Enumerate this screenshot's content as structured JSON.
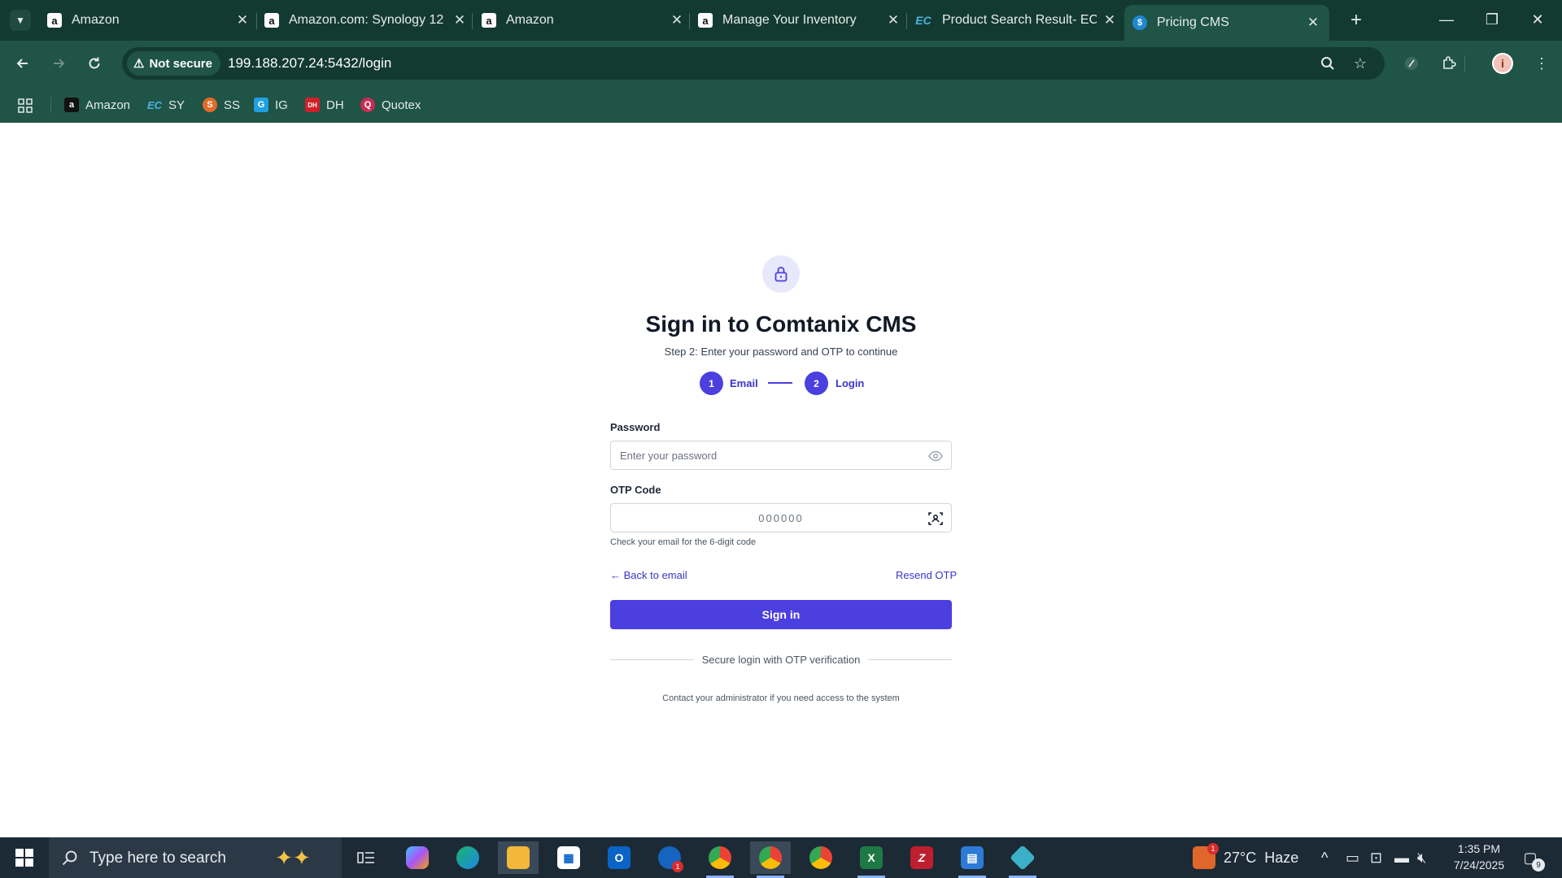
{
  "browser": {
    "tabs": [
      {
        "title": "Amazon",
        "favicon": "amazon-icon"
      },
      {
        "title": "Amazon.com: Synology 12",
        "favicon": "amazon-icon"
      },
      {
        "title": "Amazon",
        "favicon": "amazon-icon"
      },
      {
        "title": "Manage Your Inventory",
        "favicon": "amazon-icon"
      },
      {
        "title": "Product Search Result- ECF",
        "favicon": "ec-icon"
      },
      {
        "title": "Pricing CMS",
        "favicon": "pricing-cms-icon",
        "active": true
      }
    ],
    "security_label": "Not secure",
    "url": "199.188.207.24:5432/login",
    "bookmarks": [
      {
        "label": "Amazon",
        "favicon": "amazon-icon"
      },
      {
        "label": "SY",
        "favicon": "ec-icon"
      },
      {
        "label": "SS",
        "favicon": "ss-icon"
      },
      {
        "label": "IG",
        "favicon": "ig-icon"
      },
      {
        "label": "DH",
        "favicon": "dh-icon"
      },
      {
        "label": "Quotex",
        "favicon": "quotex-icon"
      }
    ],
    "colors": {
      "tabstrip": "#133a30",
      "toolbar": "#1f5446",
      "omnibox": "#133a30"
    }
  },
  "login": {
    "title": "Sign in to Comtanix CMS",
    "subtitle": "Step 2: Enter your password and OTP to continue",
    "steps": [
      {
        "number": "1",
        "label": "Email"
      },
      {
        "number": "2",
        "label": "Login"
      }
    ],
    "password_label": "Password",
    "password_placeholder": "Enter your password",
    "password_value": "",
    "otp_label": "OTP Code",
    "otp_placeholder": "000000",
    "otp_value": "",
    "otp_hint": "Check your email for the 6-digit code",
    "back_link": "← Back to email",
    "resend_link": "Resend OTP",
    "submit_label": "Sign in",
    "divider_text": "Secure login with OTP verification",
    "footnote": "Contact your administrator if you need access to the system",
    "accent_color": "#4b3fe0"
  },
  "taskbar": {
    "search_placeholder": "Type here to search",
    "apps": [
      "task-view",
      "copilot",
      "edge",
      "file-explorer",
      "microsoft-store",
      "outlook",
      "calendar-app",
      "chrome-profile-1",
      "chrome-profile-2",
      "chrome",
      "excel",
      "filezilla",
      "calculator",
      "app-diamond"
    ],
    "calendar_badge": "1",
    "weather_badge": "1",
    "weather": "27°C  Haze",
    "time": "1:35 PM",
    "date": "7/24/2025",
    "notification_count": "9"
  }
}
